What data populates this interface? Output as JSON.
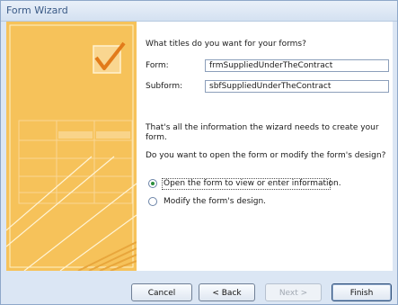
{
  "window": {
    "title": "Form Wizard"
  },
  "main": {
    "question": "What titles do you want for your forms?",
    "form_label": "Form:",
    "form_value": "frmSuppliedUnderTheContract",
    "subform_label": "Subform:",
    "subform_value": "sbfSuppliedUnderTheContract",
    "info": "That's all the information the wizard needs to create your form.",
    "prompt": "Do you want to open the form or modify the form's design?",
    "options": [
      {
        "label": "Open the form to view or enter information.",
        "checked": true
      },
      {
        "label": "Modify the form's design.",
        "checked": false
      }
    ]
  },
  "buttons": {
    "cancel": "Cancel",
    "back": "< Back",
    "next": "Next >",
    "finish": "Finish"
  },
  "colors": {
    "art_orange": "#f6c25a",
    "frame_blue": "#dbe6f4",
    "radio_green": "#2c8f3c"
  }
}
